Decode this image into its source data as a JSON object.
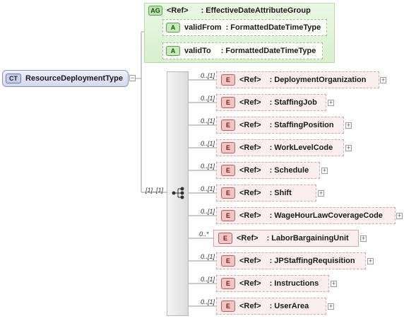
{
  "complex_type": {
    "badge": "CT",
    "name": "ResourceDeploymentType"
  },
  "attribute_group": {
    "badge": "AG",
    "ref": "<Ref>",
    "name": ": EffectiveDateAttributeGroup",
    "attributes": [
      {
        "badge": "A",
        "name": "validFrom",
        "type": ": FormattedDateTimeType"
      },
      {
        "badge": "A",
        "name": "validTo",
        "type": ": FormattedDateTimeType"
      }
    ]
  },
  "sequence": {
    "occurrence": "[1]..[1]"
  },
  "elements": [
    {
      "occurrence": "0..[1]",
      "badge": "E",
      "ref": "<Ref>",
      "name": ": DeploymentOrganization"
    },
    {
      "occurrence": "0..[1]",
      "badge": "E",
      "ref": "<Ref>",
      "name": ": StaffingJob"
    },
    {
      "occurrence": "0..[1]",
      "badge": "E",
      "ref": "<Ref>",
      "name": ": StaffingPosition"
    },
    {
      "occurrence": "0..[1]",
      "badge": "E",
      "ref": "<Ref>",
      "name": ": WorkLevelCode"
    },
    {
      "occurrence": "0..[1]",
      "badge": "E",
      "ref": "<Ref>",
      "name": ": Schedule"
    },
    {
      "occurrence": "0..[1]",
      "badge": "E",
      "ref": "<Ref>",
      "name": ": Shift"
    },
    {
      "occurrence": "0..[1]",
      "badge": "E",
      "ref": "<Ref>",
      "name": ": WageHourLawCoverageCode"
    },
    {
      "occurrence": "0..*",
      "badge": "E",
      "ref": "<Ref>",
      "name": ": LaborBargainingUnit"
    },
    {
      "occurrence": "0..[1]",
      "badge": "E",
      "ref": "<Ref>",
      "name": ": JPStaffingRequisition"
    },
    {
      "occurrence": "0..[1]",
      "badge": "E",
      "ref": "<Ref>",
      "name": ": Instructions"
    },
    {
      "occurrence": "0..[1]",
      "badge": "E",
      "ref": "<Ref>",
      "name": ": UserArea"
    }
  ],
  "toggles": {
    "collapse": "−",
    "expand": "+"
  }
}
